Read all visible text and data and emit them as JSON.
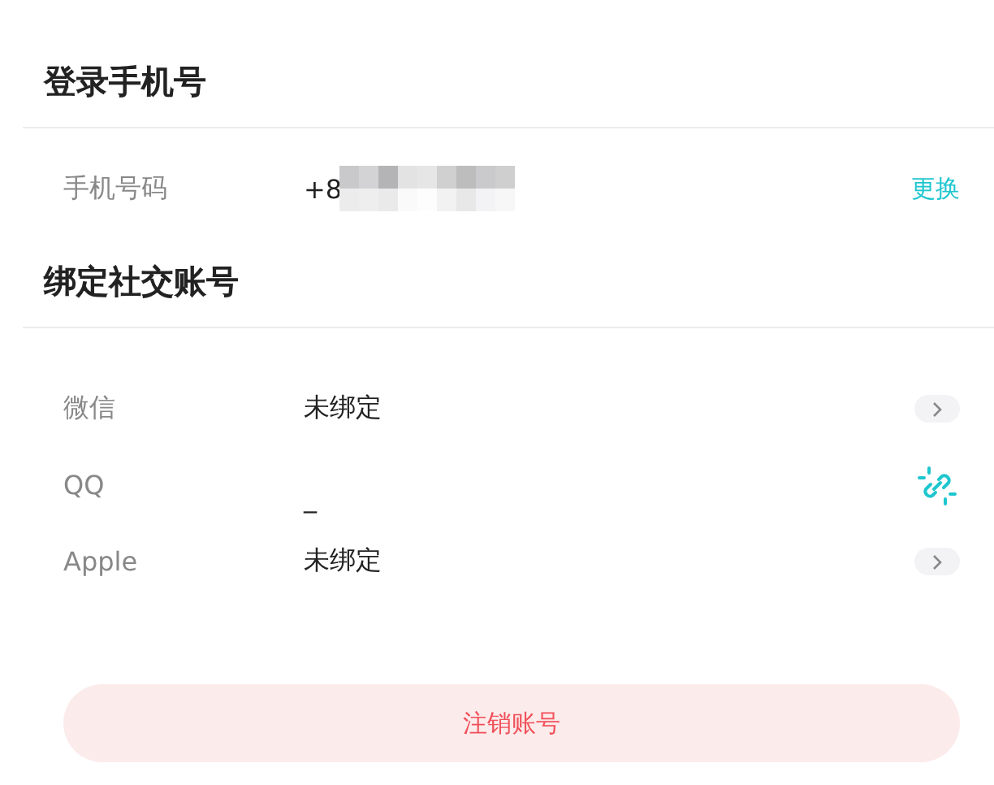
{
  "login_phone": {
    "title": "登录手机号",
    "label": "手机号码",
    "value": "+8",
    "change_link": "更换"
  },
  "social": {
    "title": "绑定社交账号",
    "accounts": [
      {
        "name": "微信",
        "status": "未绑定",
        "kind": "arrow"
      },
      {
        "name": "QQ",
        "status": "_",
        "kind": "unlink"
      },
      {
        "name": "Apple",
        "status": "未绑定",
        "kind": "arrow"
      }
    ]
  },
  "cancel_button": "注销账号"
}
